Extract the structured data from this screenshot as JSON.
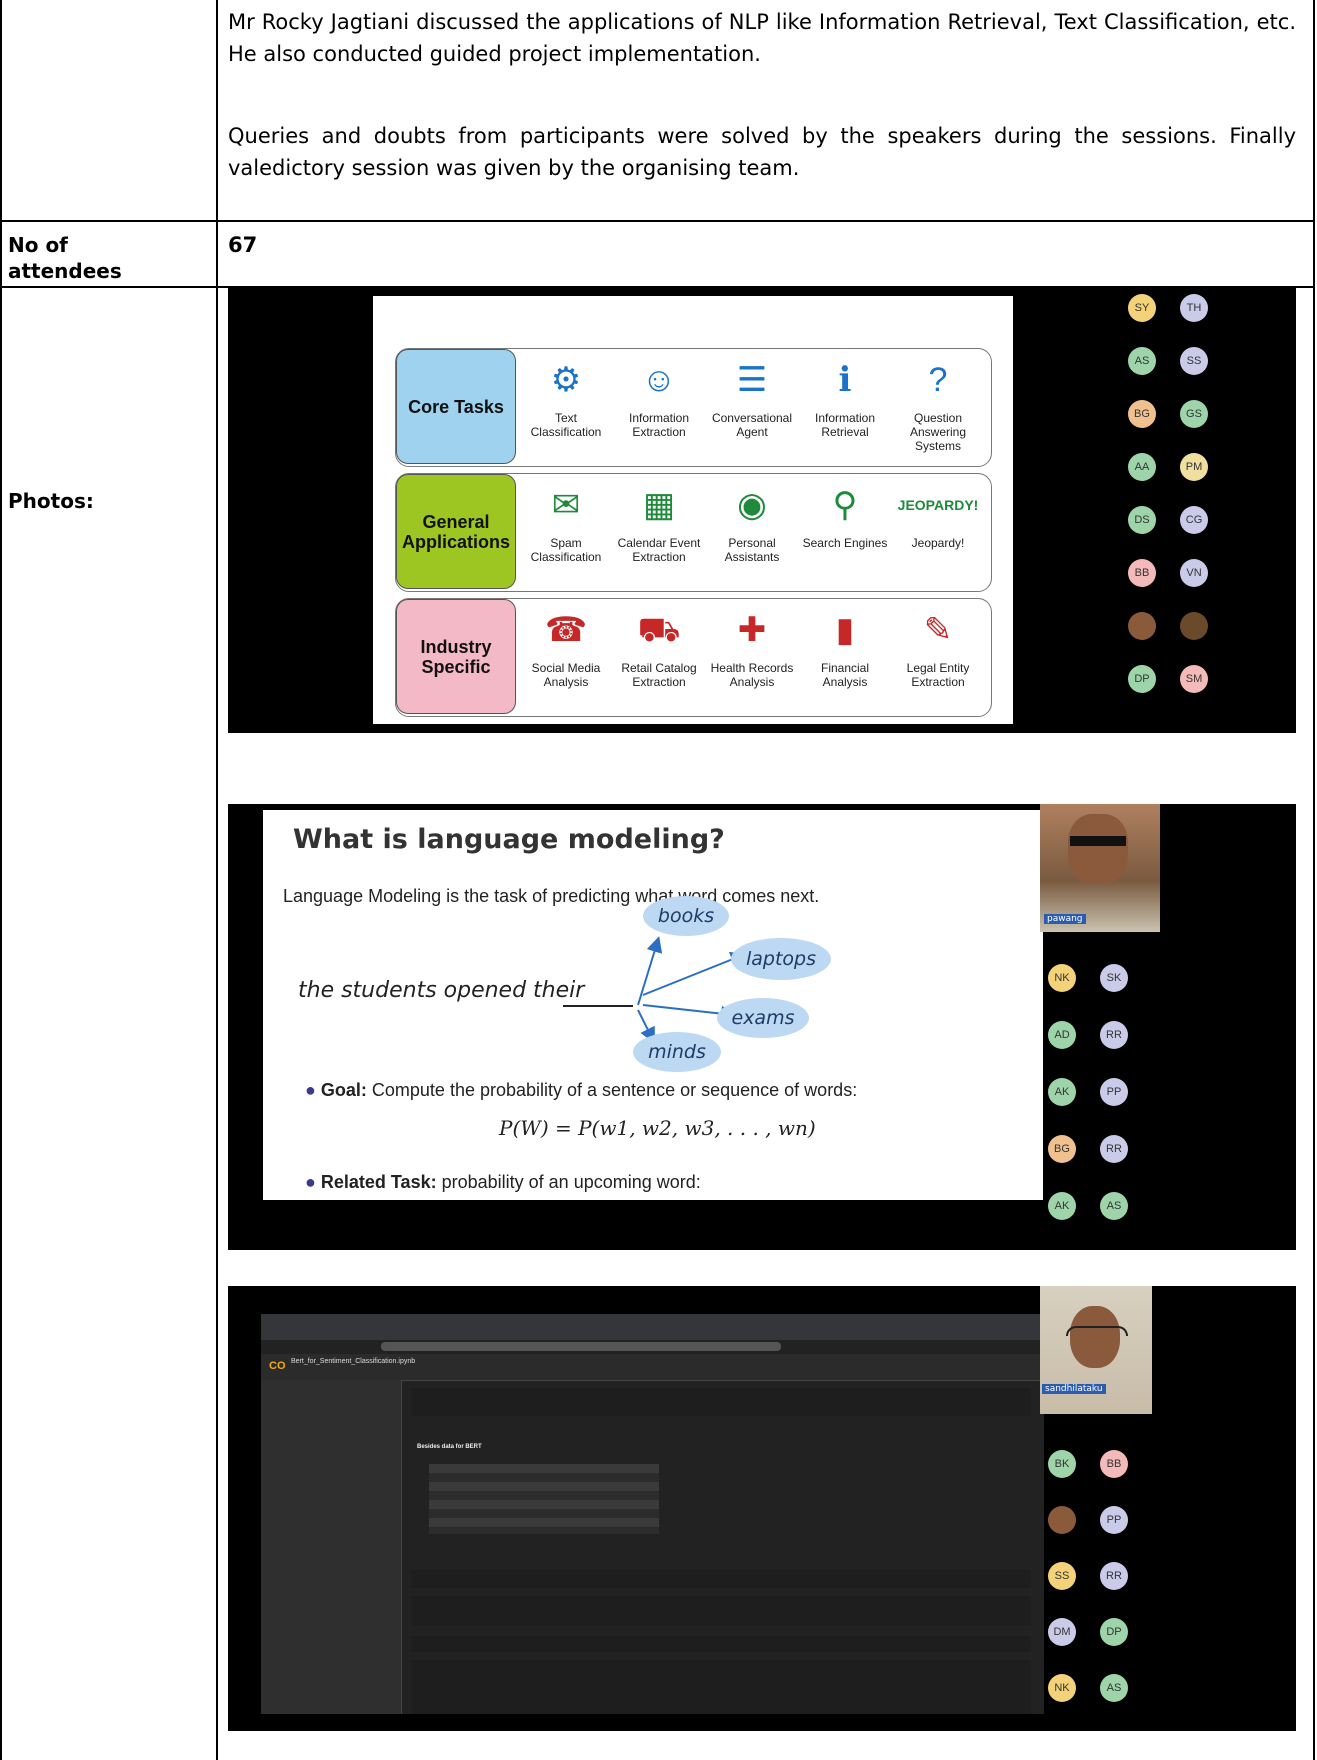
{
  "description": {
    "paragraph1": "Mr Rocky Jagtiani discussed the applications of NLP like Information Retrieval, Text Classification, etc. He also conducted guided project implementation.",
    "paragraph2": "Queries and doubts from participants were solved by the speakers during the sessions. Finally valedictory session was given by the organising team."
  },
  "attendees": {
    "label": "No of attendees",
    "value": "67"
  },
  "photos": {
    "label": "Photos:",
    "photo1": {
      "rows": [
        {
          "name": "Core Tasks",
          "color": "#9fd2ee",
          "items": [
            {
              "icon": "network-icon",
              "glyph": "⚙",
              "label": "Text Classification"
            },
            {
              "icon": "people-icon",
              "glyph": "☺",
              "label": "Information Extraction"
            },
            {
              "icon": "chat-icon",
              "glyph": "☰",
              "label": "Conversational Agent"
            },
            {
              "icon": "info-icon",
              "glyph": "ℹ",
              "label": "Information Retrieval"
            },
            {
              "icon": "question-icon",
              "glyph": "?",
              "label": "Question Answering Systems"
            }
          ]
        },
        {
          "name": "General Applications",
          "color": "#9dc622",
          "items": [
            {
              "icon": "mail-icon",
              "glyph": "✉",
              "label": "Spam Classification"
            },
            {
              "icon": "calendar-icon",
              "glyph": "▦",
              "label": "Calendar Event Extraction"
            },
            {
              "icon": "assistant-icon",
              "glyph": "◉",
              "label": "Personal Assistants"
            },
            {
              "icon": "search-icon",
              "glyph": "⚲",
              "label": "Search Engines"
            },
            {
              "icon": "jeopardy-icon",
              "glyph": "",
              "label": "Jeopardy!",
              "logo": "JEOPARDY!"
            }
          ]
        },
        {
          "name": "Industry Specific",
          "color": "#f4b9c6",
          "items": [
            {
              "icon": "social-media-icon",
              "glyph": "☎",
              "label": "Social Media Analysis"
            },
            {
              "icon": "cart-icon",
              "glyph": "⛟",
              "label": "Retail Catalog Extraction"
            },
            {
              "icon": "health-record-icon",
              "glyph": "✚",
              "label": "Health Records Analysis"
            },
            {
              "icon": "bar-chart-icon",
              "glyph": "▮",
              "label": "Financial Analysis"
            },
            {
              "icon": "legal-doc-icon",
              "glyph": "✎",
              "label": "Legal Entity Extraction"
            }
          ]
        }
      ],
      "participants": [
        {
          "initials": "SY",
          "color": "#f3d27a"
        },
        {
          "initials": "TH",
          "color": "#c9cbe8"
        },
        {
          "initials": "AS",
          "color": "#9ed4a9"
        },
        {
          "initials": "SS",
          "color": "#c9cbe8"
        },
        {
          "initials": "BG",
          "color": "#f0c18f"
        },
        {
          "initials": "GS",
          "color": "#9ed4a9"
        },
        {
          "initials": "AA",
          "color": "#9ed4a9"
        },
        {
          "initials": "PM",
          "color": "#f0e0a0"
        },
        {
          "initials": "DS",
          "color": "#9ed4a9"
        },
        {
          "initials": "CG",
          "color": "#c9cbe8"
        },
        {
          "initials": "BB",
          "color": "#f4b9b9"
        },
        {
          "initials": "VN",
          "color": "#c9cbe8"
        },
        {
          "initials": "",
          "color": "#8a5a3a"
        },
        {
          "initials": "",
          "color": "#6a4a2a"
        },
        {
          "initials": "DP",
          "color": "#9ed4a9"
        },
        {
          "initials": "SM",
          "color": "#f4b9b9"
        }
      ]
    },
    "photo2": {
      "title": "What is language modeling?",
      "intro": "Language Modeling is the task of predicting what word comes next.",
      "sentence": "the students opened their",
      "candidates": [
        "books",
        "laptops",
        "exams",
        "minds"
      ],
      "goal_label": "Goal:",
      "goal_text": "Compute the probability of a sentence or sequence of words:",
      "formula": "P(W) = P(w1, w2, w3, . . . , wn)",
      "related_label": "Related Task:",
      "related_text": "probability of an upcoming word:",
      "speaker_tag": "pawang",
      "participants": [
        {
          "initials": "NK",
          "color": "#f3d27a"
        },
        {
          "initials": "SK",
          "color": "#c9cbe8"
        },
        {
          "initials": "AD",
          "color": "#9ed4a9"
        },
        {
          "initials": "RR",
          "color": "#c9cbe8"
        },
        {
          "initials": "AK",
          "color": "#9ed4a9"
        },
        {
          "initials": "PP",
          "color": "#c9cbe8"
        },
        {
          "initials": "BG",
          "color": "#f0c18f"
        },
        {
          "initials": "RR",
          "color": "#c9cbe8"
        },
        {
          "initials": "AK",
          "color": "#9ed4a9"
        },
        {
          "initials": "AS",
          "color": "#9ed4a9"
        }
      ]
    },
    "photo3": {
      "notebook_title": "Bert_for_Sentiment_Classification.ipynb",
      "section_title": "Besides data for BERT",
      "speaker_tag": "sandhilataku",
      "participants": [
        {
          "initials": "BK",
          "color": "#9ed4a9"
        },
        {
          "initials": "BB",
          "color": "#f4b9b9"
        },
        {
          "initials": "",
          "color": "#8a5a3a"
        },
        {
          "initials": "PP",
          "color": "#c9cbe8"
        },
        {
          "initials": "SS",
          "color": "#f3d27a"
        },
        {
          "initials": "RR",
          "color": "#c9cbe8"
        },
        {
          "initials": "DM",
          "color": "#c9cbe8"
        },
        {
          "initials": "DP",
          "color": "#9ed4a9"
        },
        {
          "initials": "NK",
          "color": "#f3d27a"
        },
        {
          "initials": "AS",
          "color": "#9ed4a9"
        }
      ]
    }
  }
}
